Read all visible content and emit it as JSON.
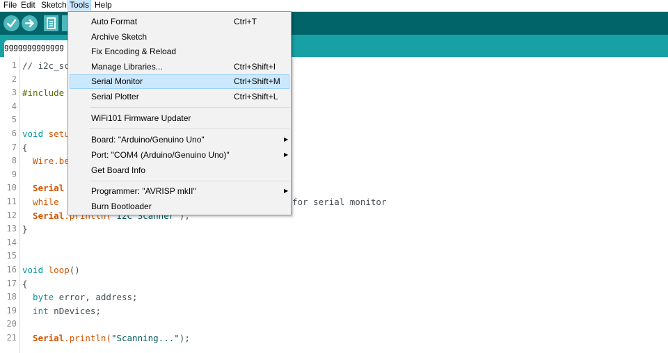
{
  "menubar": {
    "file": "File",
    "edit": "Edit",
    "sketch": "Sketch",
    "tools": "Tools",
    "help": "Help"
  },
  "tab": {
    "label": "ggggggggggggg"
  },
  "tools_menu": {
    "items": [
      {
        "label": "Auto Format",
        "shortcut": "Ctrl+T"
      },
      {
        "label": "Archive Sketch",
        "shortcut": ""
      },
      {
        "label": "Fix Encoding & Reload",
        "shortcut": ""
      },
      {
        "label": "Manage Libraries...",
        "shortcut": "Ctrl+Shift+I"
      },
      {
        "label": "Serial Monitor",
        "shortcut": "Ctrl+Shift+M"
      },
      {
        "label": "Serial Plotter",
        "shortcut": "Ctrl+Shift+L"
      },
      {
        "label": "WiFi101 Firmware Updater",
        "shortcut": ""
      },
      {
        "label": "Board: \"Arduino/Genuino Uno\"",
        "shortcut": ""
      },
      {
        "label": "Port: \"COM4 (Arduino/Genuino Uno)\"",
        "shortcut": ""
      },
      {
        "label": "Get Board Info",
        "shortcut": ""
      },
      {
        "label": "Programmer: \"AVRISP mkII\"",
        "shortcut": ""
      },
      {
        "label": "Burn Bootloader",
        "shortcut": ""
      }
    ]
  },
  "editor": {
    "line_numbers": [
      "1",
      "2",
      "3",
      "4",
      "5",
      "6",
      "7",
      "8",
      "9",
      "10",
      "11",
      "12",
      "13",
      "14",
      "15",
      "16",
      "17",
      "18",
      "19",
      "20",
      "21"
    ],
    "code": {
      "l1": "// i2c_sc",
      "l3": "#include",
      "l6_kw": "void",
      "l6_rest": " setu",
      "l7": "{",
      "l8": "  Wire.be",
      "l10": "  Serial",
      "l11_kw": "  while",
      "l11_comment": "for serial monitor",
      "l12_obj": "  Serial",
      "l12_fn": ".println(",
      "l12_str": "\"I2C Scanner\"",
      "l12_end": ");",
      "l13": "}",
      "l16_kw": "void",
      "l16_fn": " loop",
      "l16_rest": "()",
      "l17": "{",
      "l18_kw": "  byte",
      "l18_rest": " error, address;",
      "l19_kw": "  int",
      "l19_rest": " nDevices;",
      "l21_obj": "  Serial",
      "l21_fn": ".println(",
      "l21_str": "\"Scanning...\"",
      "l21_end": ");"
    }
  },
  "colors": {
    "toolbar": "#006468",
    "tabstrip": "#17a1a5",
    "button": "#4db7bb",
    "highlight": "#cce8ff"
  }
}
